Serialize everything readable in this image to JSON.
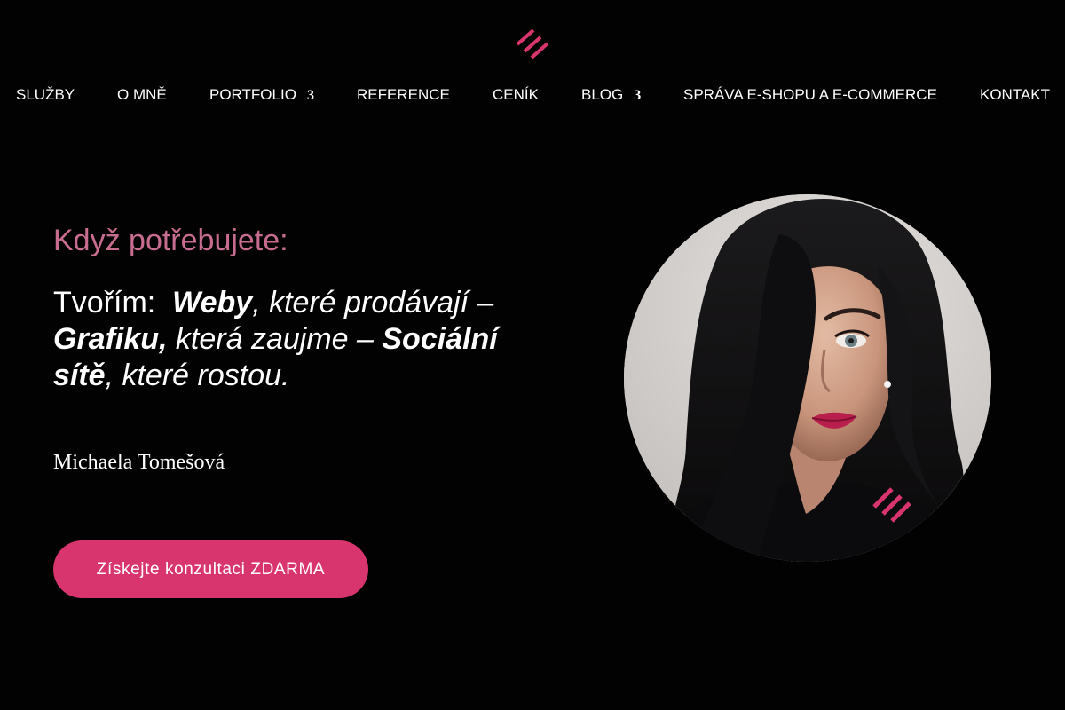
{
  "header": {
    "logo_icon": "triple-slash-logo",
    "accent_color": "#d8356f",
    "nav": [
      {
        "label": "SLUŽBY",
        "has_submenu": false
      },
      {
        "label": "O MNĚ",
        "has_submenu": false
      },
      {
        "label": "PORTFOLIO",
        "has_submenu": true,
        "submenu_icon": "3"
      },
      {
        "label": "REFERENCE",
        "has_submenu": false
      },
      {
        "label": "CENÍK",
        "has_submenu": false
      },
      {
        "label": "BLOG",
        "has_submenu": true,
        "submenu_icon": "3"
      },
      {
        "label": "SPRÁVA E-SHOPU A E-COMMERCE",
        "has_submenu": false
      },
      {
        "label": "KONTAKT",
        "has_submenu": false
      }
    ]
  },
  "hero": {
    "eyebrow": "Když potřebujete:",
    "headline": {
      "lead": "Tvořím:  ",
      "p1": "Weby",
      "p2": ", které prodávají – ",
      "p3": "Grafiku,",
      "p4": " která zaujme – ",
      "p5": "Sociální sítě",
      "p6": ", které rostou."
    },
    "signature": "Michaela Tomešová",
    "cta_label": "Získejte konzultaci ZDARMA",
    "eyebrow_color": "#c86c90"
  },
  "portrait": {
    "subject": "woman-portrait-photo",
    "watermark_icon": "triple-slash-logo"
  }
}
